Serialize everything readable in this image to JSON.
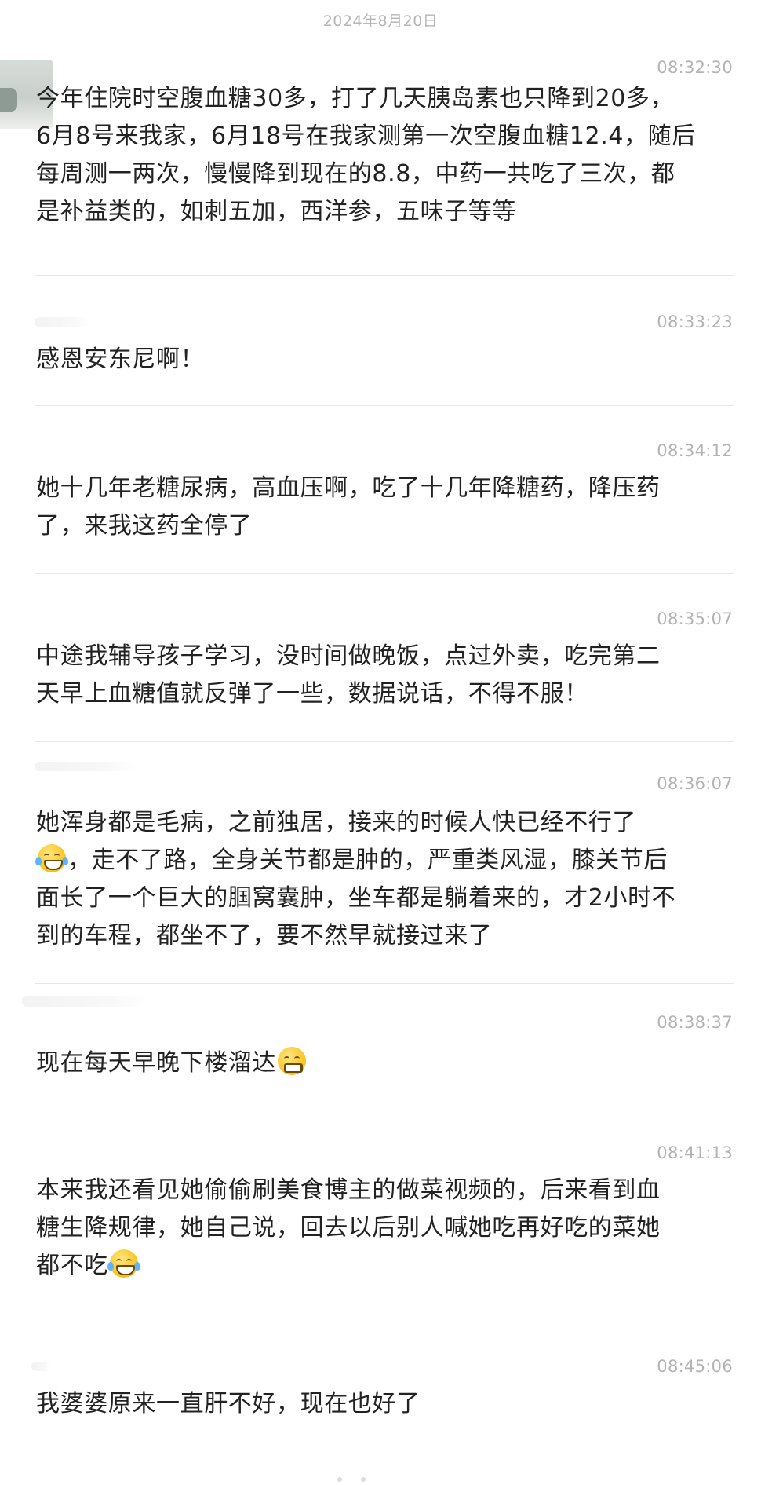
{
  "chat": {
    "date": "2024年8月20日",
    "messages": [
      {
        "time": "08:32:30",
        "lines": [
          "今年住院时空腹血糖30多，打了几天胰岛素也只降到20多，",
          "6月8号来我家，6月18号在我家测第一次空腹血糖12.4，随后",
          "每周测一两次，慢慢降到现在的8.8，中药一共吃了三次，都",
          "是补益类的，如刺五加，西洋参，五味子等等"
        ]
      },
      {
        "time": "08:33:23",
        "lines": [
          "感恩安东尼啊！"
        ]
      },
      {
        "time": "08:34:12",
        "lines": [
          "她十几年老糖尿病，高血压啊，吃了十几年降糖药，降压药",
          "了，来我这药全停了"
        ]
      },
      {
        "time": "08:35:07",
        "lines": [
          "中途我辅导孩子学习，没时间做晚饭，点过外卖，吃完第二",
          "天早上血糖值就反弹了一些，数据说话，不得不服！"
        ]
      },
      {
        "time": "08:36:07",
        "line1": "她浑身都是毛病，之前独居，接来的时候人快已经不行了",
        "line2": "，走不了路，全身关节都是肿的，严重类风湿，膝关节后",
        "line3": "面长了一个巨大的腘窝囊肿，坐车都是躺着来的，才2小时不",
        "line4": "到的车程，都坐不了，要不然早就接过来了",
        "emoji": "crying-face-emoji"
      },
      {
        "time": "08:38:37",
        "text": "现在每天早晚下楼溜达",
        "emoji": "grinning-face-emoji"
      },
      {
        "time": "08:41:13",
        "line1": "本来我还看见她偷偷刷美食博主的做菜视频的，后来看到血",
        "line2": "糖生降规律，她自己说，回去以后别人喊她吃再好吃的菜她",
        "line3": "都不吃",
        "emoji": "tears-of-joy-emoji"
      },
      {
        "time": "08:45:06",
        "lines": [
          "我婆婆原来一直肝不好，现在也好了"
        ]
      }
    ]
  },
  "colors": {
    "background": "#ffffff",
    "text": "#222222",
    "timestamp": "#b3b3b3",
    "divider": "#e7e7e7",
    "date": "#b5b5b5"
  }
}
